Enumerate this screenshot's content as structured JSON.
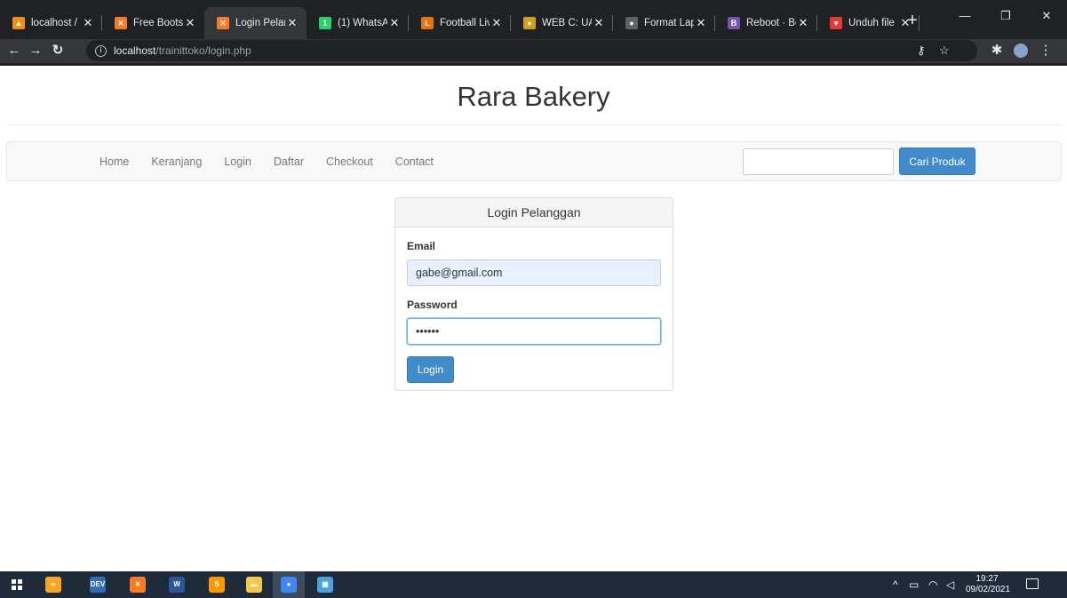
{
  "browser": {
    "tabs": [
      {
        "title": "localhost /",
        "icon": "phpmyadmin-icon",
        "color": "#f29111",
        "glyph": "▲"
      },
      {
        "title": "Free Bootst",
        "icon": "xampp-icon",
        "color": "#fb7a24",
        "glyph": "✕"
      },
      {
        "title": "Login Pelan",
        "icon": "xampp-icon",
        "color": "#fb7a24",
        "glyph": "✕"
      },
      {
        "title": "(1) WhatsA",
        "icon": "whatsapp-icon",
        "color": "#25d366",
        "glyph": "1"
      },
      {
        "title": "Football Liv",
        "icon": "football-icon",
        "color": "#e8720c",
        "glyph": "L"
      },
      {
        "title": "WEB C: UAS",
        "icon": "web-icon",
        "color": "#d4a017",
        "glyph": "●"
      },
      {
        "title": "Format Lap",
        "icon": "globe-icon",
        "color": "#5f6368",
        "glyph": "●"
      },
      {
        "title": "Reboot · Bo",
        "icon": "bootstrap-icon",
        "color": "#7952b3",
        "glyph": "B"
      },
      {
        "title": "Unduh file |",
        "icon": "heart-icon",
        "color": "#e53935",
        "glyph": "♥"
      }
    ],
    "active_tab": 2,
    "url_host": "localhost",
    "url_path": "/trainittoko/login.php"
  },
  "site": {
    "title": "Rara Bakery"
  },
  "nav": {
    "links": [
      "Home",
      "Keranjang",
      "Login",
      "Daftar",
      "Checkout",
      "Contact"
    ],
    "search_value": "",
    "search_button": "Cari Produk"
  },
  "login": {
    "heading": "Login Pelanggan",
    "email_label": "Email",
    "email_value": "gabe@gmail.com",
    "password_label": "Password",
    "password_value": "••••••",
    "button": "Login"
  },
  "taskbar": {
    "apps": [
      {
        "name": "xampp-control-icon",
        "color": "#f5a623",
        "glyph": "∞"
      },
      {
        "name": "dev-cpp-icon",
        "color": "#2f6db5",
        "glyph": "DEV"
      },
      {
        "name": "xampp-taskbar-icon",
        "color": "#fb7a24",
        "glyph": "✕"
      },
      {
        "name": "word-icon",
        "color": "#2b5797",
        "glyph": "W"
      },
      {
        "name": "sublime-icon",
        "color": "#ff9800",
        "glyph": "S"
      },
      {
        "name": "file-explorer-icon",
        "color": "#f7c948",
        "glyph": "▬"
      },
      {
        "name": "chrome-icon",
        "color": "#4285f4",
        "glyph": "●"
      },
      {
        "name": "app-icon",
        "color": "#4aa3df",
        "glyph": "▣"
      }
    ],
    "time": "19:27",
    "date": "09/02/2021"
  }
}
